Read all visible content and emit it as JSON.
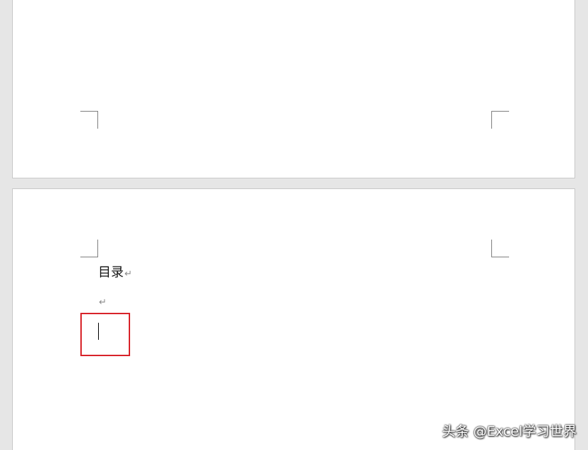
{
  "document": {
    "pages": [
      {
        "content": ""
      },
      {
        "toc_heading": "目录",
        "paragraph_mark": "↵",
        "empty_paragraph": ""
      }
    ]
  },
  "watermark": {
    "text": "头条 @Excel学习世界"
  },
  "colors": {
    "highlight": "#d8232a",
    "workspace": "#e6e6e6",
    "page": "#ffffff"
  }
}
